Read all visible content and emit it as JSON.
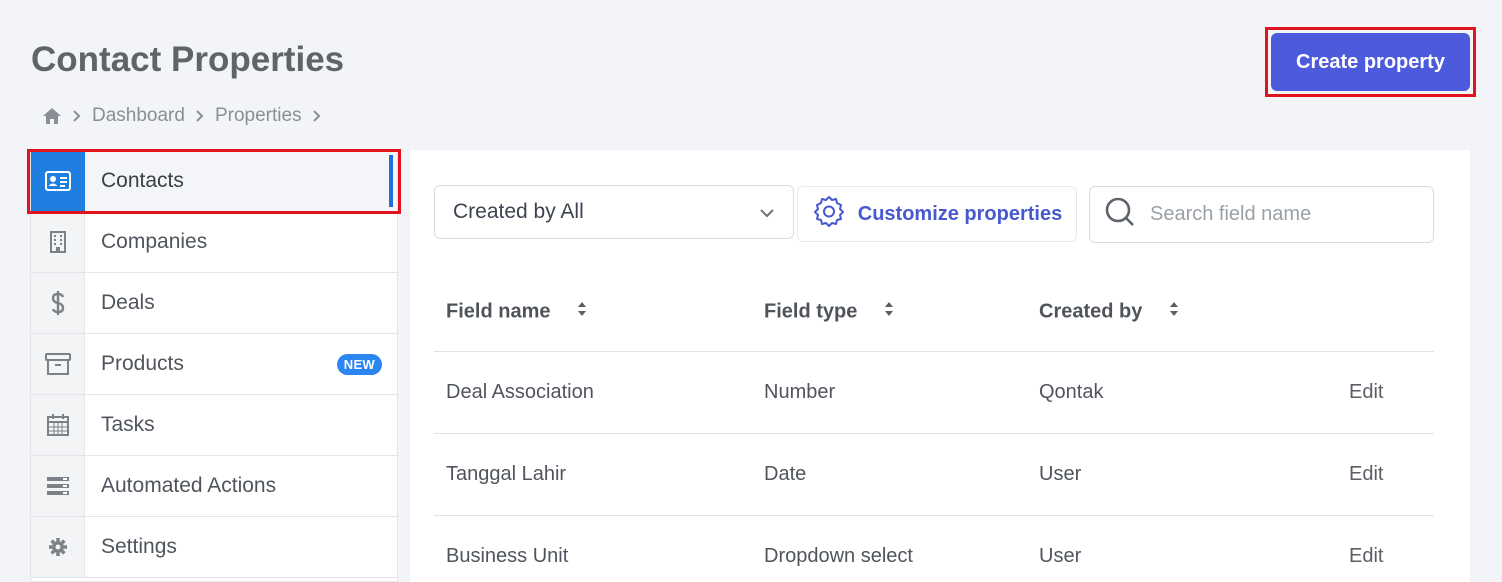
{
  "page": {
    "title": "Contact Properties",
    "create_label": "Create property"
  },
  "breadcrumb": {
    "home_icon": "home-icon",
    "items": [
      "Dashboard",
      "Properties"
    ]
  },
  "sidebar": {
    "items": [
      {
        "label": "Contacts",
        "icon": "contact-card-icon",
        "active": true
      },
      {
        "label": "Companies",
        "icon": "building-icon"
      },
      {
        "label": "Deals",
        "icon": "dollar-icon"
      },
      {
        "label": "Products",
        "icon": "archive-box-icon",
        "badge": "NEW"
      },
      {
        "label": "Tasks",
        "icon": "calendar-icon"
      },
      {
        "label": "Automated Actions",
        "icon": "server-icon"
      },
      {
        "label": "Settings",
        "icon": "gear-icon"
      }
    ]
  },
  "toolbar": {
    "filter_value": "Created by All",
    "customize_label": "Customize properties",
    "search_placeholder": "Search field name"
  },
  "table": {
    "headers": [
      "Field name",
      "Field type",
      "Created by"
    ],
    "rows": [
      {
        "name": "Deal Association",
        "type": "Number",
        "created_by": "Qontak",
        "action": "Edit"
      },
      {
        "name": "Tanggal Lahir",
        "type": "Date",
        "created_by": "User",
        "action": "Edit"
      },
      {
        "name": "Business Unit",
        "type": "Dropdown select",
        "created_by": "User",
        "action": "Edit"
      }
    ]
  },
  "colors": {
    "primary_button": "#4b5bdc",
    "active_sidebar": "#1f7fe0",
    "highlight_outline": "#e0141e",
    "badge": "#2a86f0"
  }
}
